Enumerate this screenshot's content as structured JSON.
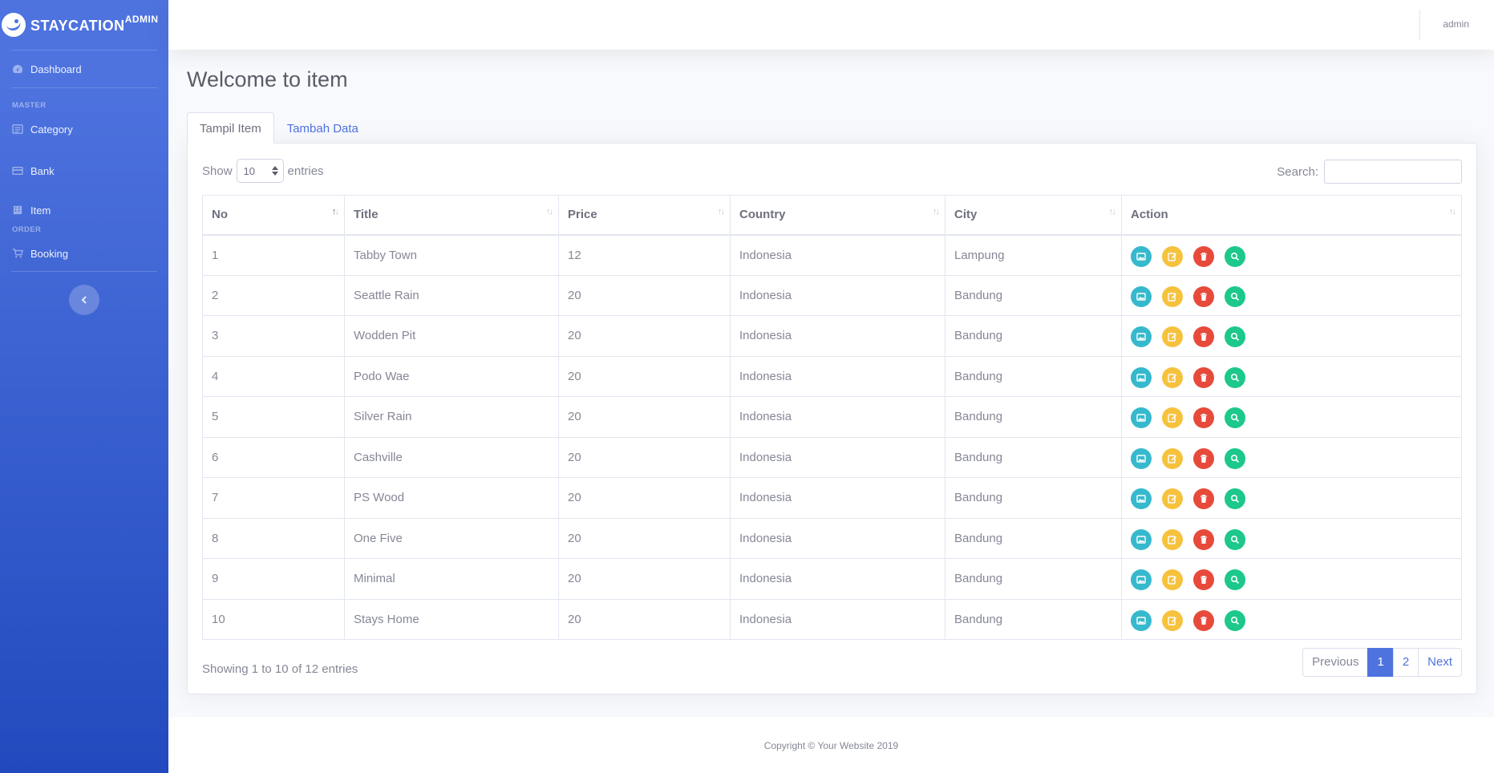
{
  "brand": {
    "name": "STAYCATION",
    "suffix": "ADMIN"
  },
  "sidebar": {
    "dashboard": "Dashboard",
    "heading_master": "MASTER",
    "category": "Category",
    "bank": "Bank",
    "item": "Item",
    "heading_order": "ORDER",
    "booking": "Booking"
  },
  "topbar": {
    "user": "admin"
  },
  "page": {
    "title": "Welcome to item"
  },
  "tabs": [
    {
      "label": "Tampil Item",
      "active": true
    },
    {
      "label": "Tambah Data",
      "active": false
    }
  ],
  "table_controls": {
    "show_label": "Show",
    "page_size": "10",
    "entries_label": "entries",
    "search_label": "Search:",
    "search_value": ""
  },
  "table": {
    "columns": [
      "No",
      "Title",
      "Price",
      "Country",
      "City",
      "Action"
    ],
    "rows": [
      {
        "no": "1",
        "title": "Tabby Town",
        "price": "12",
        "country": "Indonesia",
        "city": "Lampung"
      },
      {
        "no": "2",
        "title": "Seattle Rain",
        "price": "20",
        "country": "Indonesia",
        "city": "Bandung"
      },
      {
        "no": "3",
        "title": "Wodden Pit",
        "price": "20",
        "country": "Indonesia",
        "city": "Bandung"
      },
      {
        "no": "4",
        "title": "Podo Wae",
        "price": "20",
        "country": "Indonesia",
        "city": "Bandung"
      },
      {
        "no": "5",
        "title": "Silver Rain",
        "price": "20",
        "country": "Indonesia",
        "city": "Bandung"
      },
      {
        "no": "6",
        "title": "Cashville",
        "price": "20",
        "country": "Indonesia",
        "city": "Bandung"
      },
      {
        "no": "7",
        "title": "PS Wood",
        "price": "20",
        "country": "Indonesia",
        "city": "Bandung"
      },
      {
        "no": "8",
        "title": "One Five",
        "price": "20",
        "country": "Indonesia",
        "city": "Bandung"
      },
      {
        "no": "9",
        "title": "Minimal",
        "price": "20",
        "country": "Indonesia",
        "city": "Bandung"
      },
      {
        "no": "10",
        "title": "Stays Home",
        "price": "20",
        "country": "Indonesia",
        "city": "Bandung"
      }
    ],
    "action_icons": [
      "image-icon",
      "edit-icon",
      "trash-icon",
      "search-icon"
    ]
  },
  "pagination": {
    "info": "Showing 1 to 10 of 12 entries",
    "previous": "Previous",
    "pages": [
      "1",
      "2"
    ],
    "next": "Next"
  },
  "footer": {
    "copyright": "Copyright © Your Website 2019"
  },
  "colors": {
    "primary": "#4e73df",
    "info": "#36b9cc",
    "warning": "#f6c23e",
    "danger": "#e74a3b",
    "success": "#1cc88a"
  }
}
